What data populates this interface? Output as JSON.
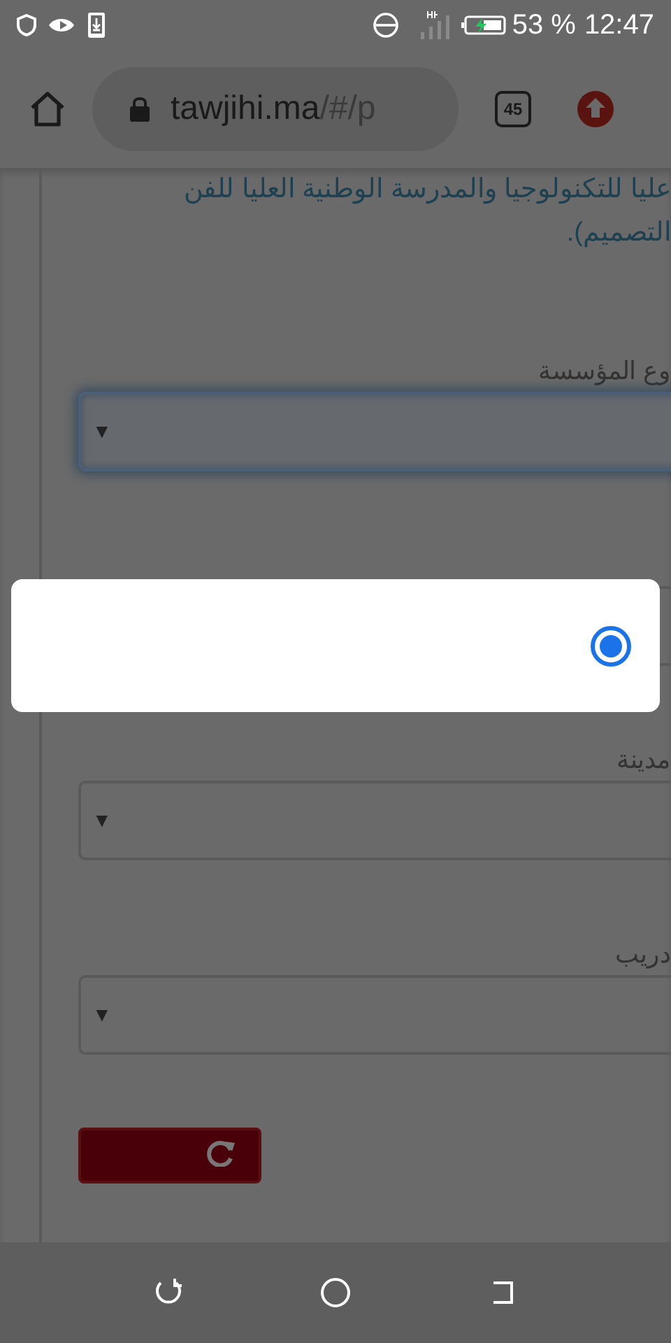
{
  "status_bar": {
    "battery": "53 %",
    "time": "12:47"
  },
  "browser": {
    "url_host": "tawjihi.ma",
    "url_path": "/#/p",
    "tab_count": "45"
  },
  "page": {
    "paragraph_lines": [
      "عليا للتكنولوجيا والمدرسة الوطنية العليا للفن",
      "التصميم)."
    ],
    "fields": [
      {
        "label": "وع المؤسسة",
        "arrow": "▼",
        "focused": true
      },
      {
        "focused": false
      },
      {
        "label": "مدينة",
        "arrow": "▼",
        "focused": false
      },
      {
        "label": "دريب",
        "arrow": "▼",
        "focused": false
      }
    ]
  },
  "dialog": {
    "options": [
      {
        "selected": true
      }
    ]
  }
}
